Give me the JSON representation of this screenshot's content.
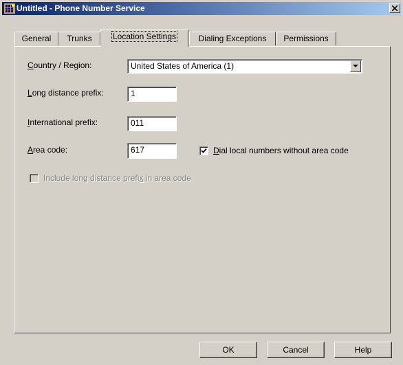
{
  "window": {
    "title": "Untitled - Phone Number Service"
  },
  "tabs": [
    {
      "label": "General"
    },
    {
      "label": "Trunks"
    },
    {
      "label": "Location Settings"
    },
    {
      "label": "Dialing Exceptions"
    },
    {
      "label": "Permissions"
    }
  ],
  "active_tab": "Location Settings",
  "form": {
    "country_label": "ountry / Region:",
    "country_accel": "C",
    "country_value": "United States of America (1)",
    "long_distance_label": "ong distance prefix:",
    "long_distance_accel": "L",
    "long_distance_value": "1",
    "international_label": "nternational prefix:",
    "international_accel": "I",
    "international_value": "011",
    "area_code_label": "rea code:",
    "area_code_accel": "A",
    "area_code_value": "617",
    "dial_local_accel": "D",
    "dial_local_label": "ial local numbers without area code",
    "dial_local_checked": true,
    "include_prefix_label_1": "Include long distance prefi",
    "include_prefix_accel": "x",
    "include_prefix_label_2": " in area code",
    "include_prefix_checked": false,
    "include_prefix_enabled": false
  },
  "buttons": {
    "ok": "OK",
    "cancel": "Cancel",
    "help": "Help"
  },
  "colors": {
    "face": "#d4d0c8",
    "title_start": "#0a246a",
    "title_end": "#a6caf0"
  },
  "icons": {
    "title": "phone-service-icon",
    "close": "close-icon",
    "dropdown": "chevron-down-icon",
    "check": "checkmark-icon"
  }
}
